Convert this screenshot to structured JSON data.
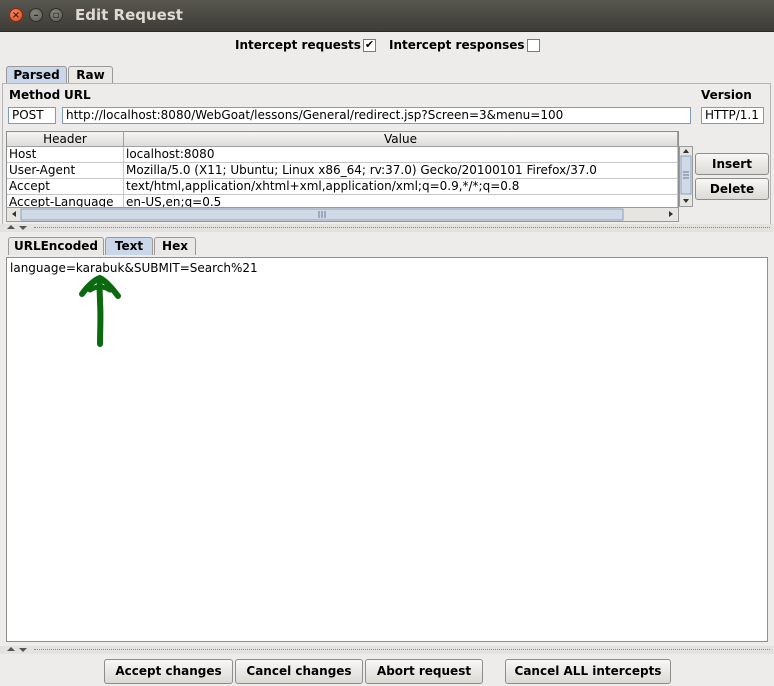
{
  "window": {
    "title": "Edit Request"
  },
  "intercept": {
    "requests_label": "Intercept requests :",
    "requests_checked": true,
    "responses_label": "Intercept responses :",
    "responses_checked": false
  },
  "top_tabs": [
    "Parsed",
    "Raw"
  ],
  "request_line": {
    "method_label": "Method",
    "url_label": "URL",
    "version_label": "Version",
    "method": "POST",
    "url": "http://localhost:8080/WebGoat/lessons/General/redirect.jsp?Screen=3&menu=100",
    "version": "HTTP/1.1"
  },
  "headers_table": {
    "columns": [
      "Header",
      "Value"
    ],
    "rows": [
      {
        "header": "Host",
        "value": "localhost:8080"
      },
      {
        "header": "User-Agent",
        "value": "Mozilla/5.0 (X11; Ubuntu; Linux x86_64; rv:37.0) Gecko/20100101 Firefox/37.0"
      },
      {
        "header": "Accept",
        "value": "text/html,application/xhtml+xml,application/xml;q=0.9,*/*;q=0.8"
      },
      {
        "header": "Accept-Language",
        "value": "en-US,en;q=0.5"
      }
    ]
  },
  "side_buttons": {
    "insert": "Insert",
    "delete": "Delete"
  },
  "body_tabs": [
    "URLEncoded",
    "Text",
    "Hex"
  ],
  "body_text": "language=karabuk&SUBMIT=Search%21",
  "annotation": {
    "color": "#0b6a10",
    "icon": "arrow-up-icon"
  },
  "footer_buttons": {
    "accept": "Accept changes",
    "cancel": "Cancel changes",
    "abort": "Abort request",
    "cancel_all": "Cancel ALL intercepts"
  },
  "colors": {
    "titlebar": "#3d3c37",
    "active_tab": "#c9d7e8",
    "background": "#edecea"
  }
}
